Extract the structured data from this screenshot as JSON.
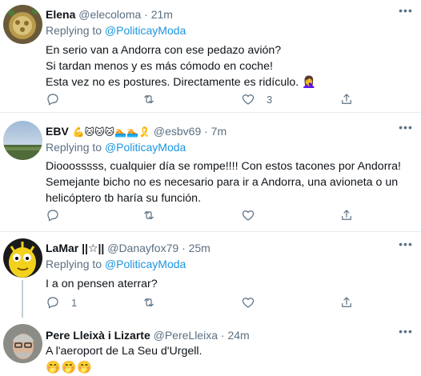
{
  "tweets": [
    {
      "name": "Elena",
      "name_emoji": "",
      "handle": "@elecoloma",
      "time": "· 21m",
      "replying_prefix": "Replying to",
      "replying_to": "@PoliticayModa",
      "lines": [
        "En serio van a Andorra con ese pedazo avión?",
        "Si tardan menos y es más cómodo en coche!",
        "Esta vez no es postures. Directamente es ridículo. 🤦‍♀️"
      ],
      "reply_count": "",
      "retweet_count": "",
      "like_count": "3"
    },
    {
      "name": "EBV",
      "name_emoji": "💪🐱🐱🐱🏊🏊🎗️",
      "handle": "@esbv69",
      "time": "· 7m",
      "replying_prefix": "Replying to",
      "replying_to": "@PoliticayModa",
      "lines": [
        "Diooosssss, cualquier día se rompe!!!! Con estos tacones por Andorra!",
        "Semejante bicho no es necesario para ir a Andorra, una avioneta o un",
        "helicóptero tb haría su función."
      ],
      "reply_count": "",
      "retweet_count": "",
      "like_count": ""
    },
    {
      "name": "LaMar ||☆||",
      "name_emoji": "",
      "handle": "@Danayfox79",
      "time": "· 25m",
      "replying_prefix": "Replying to",
      "replying_to": "@PoliticayModa",
      "lines": [
        "I a on pensen aterrar?"
      ],
      "reply_count": "1",
      "retweet_count": "",
      "like_count": ""
    },
    {
      "name": "Pere Lleixà i Lizarte",
      "name_emoji": "",
      "handle": "@PereLleixa",
      "time": "· 24m",
      "lines": [
        "A l'aeroport de La Seu d'Urgell."
      ],
      "emoji_line": "🤭🤭🤭"
    }
  ],
  "icons": {
    "more": "more-icon",
    "reply": "reply-icon",
    "retweet": "retweet-icon",
    "like": "like-icon",
    "share": "share-icon"
  },
  "colors": {
    "mention": "#1b95e0",
    "secondary_text": "#5b7083",
    "divider": "#e6ecf0"
  }
}
